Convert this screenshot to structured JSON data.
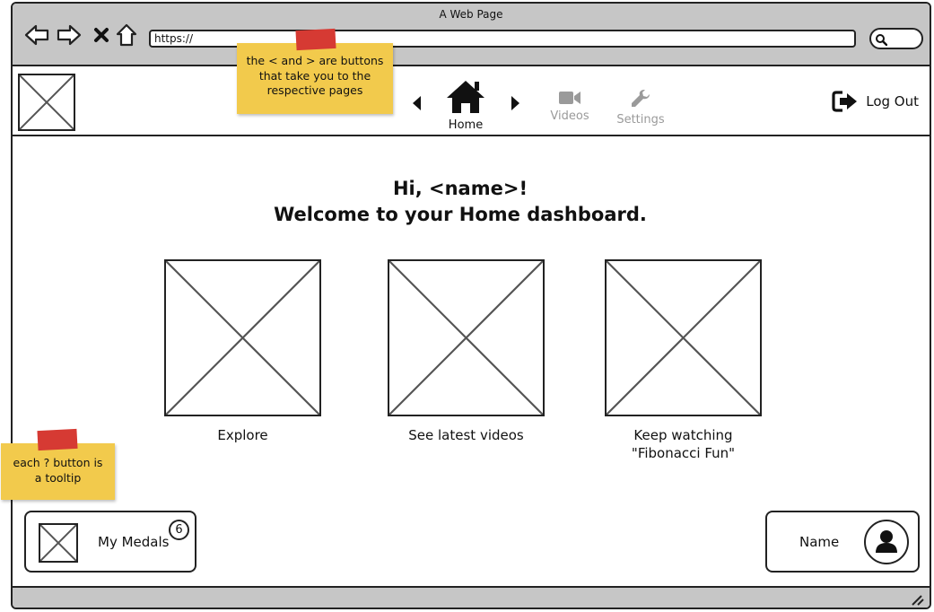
{
  "window": {
    "title": "A Web Page",
    "url": "https://"
  },
  "browser_controls": {
    "icons": [
      "back-arrow-icon",
      "forward-arrow-icon",
      "close-x-icon",
      "home-outline-icon",
      "search-icon"
    ]
  },
  "header": {
    "nav": {
      "prev_icon": "caret-left-icon",
      "next_icon": "caret-right-icon",
      "items": [
        {
          "label": "Home",
          "icon": "home-icon",
          "active": true
        },
        {
          "label": "Videos",
          "icon": "video-camera-icon",
          "active": false
        },
        {
          "label": "Settings",
          "icon": "wrench-icon",
          "active": false
        }
      ]
    },
    "logout_label": "Log Out"
  },
  "notes": {
    "nav_note": "the < and > are buttons that take you to the respective pages",
    "tooltip_note": "each ? button is a tooltip"
  },
  "main": {
    "greeting_line1": "Hi, <name>!",
    "greeting_line2": "Welcome to your Home dashboard.",
    "cards": [
      {
        "caption": "Explore"
      },
      {
        "caption": "See latest videos"
      },
      {
        "caption": "Keep watching\n\"Fibonacci Fun\""
      }
    ]
  },
  "footer": {
    "medals_label": "My Medals",
    "medals_count": "6",
    "profile_label": "Name"
  },
  "colors": {
    "chrome": "#c6c6c6",
    "sticky_note": "#f2ca4c",
    "tape": "#d63a33",
    "inactive_nav": "#9a9a9a"
  }
}
